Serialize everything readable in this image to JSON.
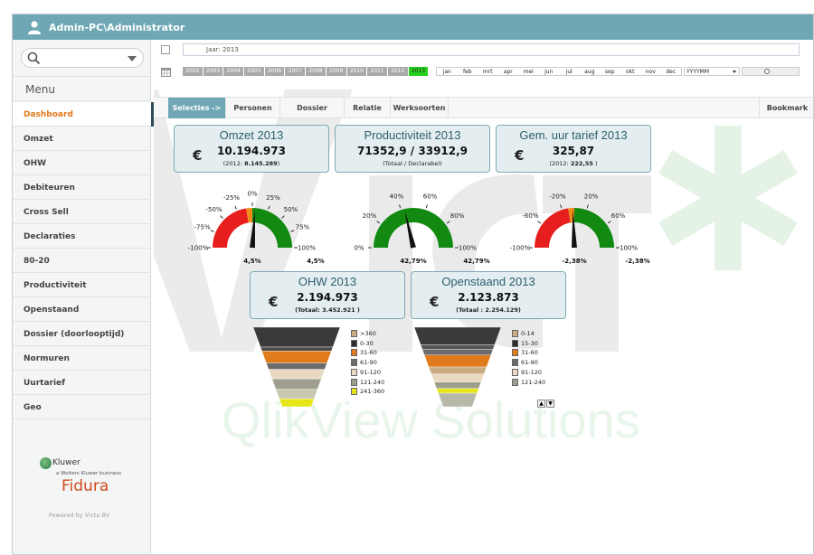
{
  "window": {
    "title": "Admin-PC\\Administrator"
  },
  "sidebar": {
    "menu_title": "Menu",
    "items": [
      {
        "label": "Dashboard",
        "active": true
      },
      {
        "label": "Omzet"
      },
      {
        "label": "OHW"
      },
      {
        "label": "Debiteuren"
      },
      {
        "label": "Cross Sell"
      },
      {
        "label": "Declaraties"
      },
      {
        "label": "80-20"
      },
      {
        "label": "Productiviteit"
      },
      {
        "label": "Openstaand"
      },
      {
        "label": "Dossier (doorlooptijd)"
      },
      {
        "label": "Normuren"
      },
      {
        "label": "Uurtarief"
      },
      {
        "label": "Geo"
      }
    ],
    "logo_kluwer": "Kluwer",
    "logo_kluwer_sub": "a Wolters Kluwer business",
    "logo_fidura": "Fidura",
    "powered_by": "Powered by Victa BV"
  },
  "filters": {
    "jaar_label": "Jaar: 2013",
    "years": [
      "2002",
      "2003",
      "2004",
      "2005",
      "2006",
      "2007",
      "2008",
      "2009",
      "2010",
      "2011",
      "2012",
      "2013"
    ],
    "selected_year": "2013",
    "months": [
      "jan",
      "feb",
      "mrt",
      "apr",
      "mei",
      "jun",
      "jul",
      "aug",
      "sep",
      "okt",
      "nov",
      "dec"
    ],
    "period_select": "YYYYMM"
  },
  "tabs": {
    "items": [
      "Selecties ->",
      "Personen",
      "Dossier",
      "Relatie",
      "Werksoorten"
    ],
    "bookmark": "Bookmark"
  },
  "kpis": {
    "omzet": {
      "title": "Omzet 2013",
      "currency": "€",
      "value": "10.194.973",
      "sub_pre": "(2012: ",
      "sub_val": "8.145.289",
      "sub_post": ")"
    },
    "productiviteit": {
      "title": "Productiviteit 2013",
      "value": "71352,9 / 33912,9",
      "sub": "(Totaal / Declarabel)"
    },
    "uurtarief": {
      "title": "Gem. uur tarief 2013",
      "currency": "€",
      "value": "325,87",
      "sub_pre": "(2012: ",
      "sub_val": "222,55",
      "sub_post": " )"
    },
    "ohw": {
      "title": "OHW 2013",
      "currency": "€",
      "value": "2.194.973",
      "sub": "(Totaal: 3.452.921 )"
    },
    "openstaand": {
      "title": "Openstaand 2013",
      "currency": "€",
      "value": "2.123.873",
      "sub": "(Totaal : 2.254.129)"
    }
  },
  "gauges": {
    "omzet": {
      "min": -100,
      "max": 100,
      "value": 4.5,
      "ticks": [
        "-100%",
        "-75%",
        "-50%",
        "-25%",
        "0%",
        "25%",
        "50%",
        "75%",
        "100%"
      ],
      "label_left": "4,5%",
      "label_right": "4,5%",
      "bands": [
        {
          "from": -100,
          "to": -10,
          "color": "#e61e1e"
        },
        {
          "from": -10,
          "to": 0,
          "color": "#f08a1a"
        },
        {
          "from": 0,
          "to": 100,
          "color": "#128a12"
        }
      ]
    },
    "productiviteit": {
      "min": 0,
      "max": 100,
      "value": 42.79,
      "ticks": [
        "0%",
        "20%",
        "40%",
        "60%",
        "80%",
        "100%"
      ],
      "label_left": "42,79%",
      "label_right": "42,79%",
      "bands": [
        {
          "from": 0,
          "to": 100,
          "color": "#128a12"
        }
      ]
    },
    "uurtarief": {
      "min": -100,
      "max": 100,
      "value": -2.38,
      "ticks": [
        "-100%",
        "-60%",
        "-20%",
        "20%",
        "60%",
        "100%"
      ],
      "label_left": "-2,38%",
      "label_right": "-2,38%",
      "bands": [
        {
          "from": -100,
          "to": -10,
          "color": "#e61e1e"
        },
        {
          "from": -10,
          "to": 0,
          "color": "#f08a1a"
        },
        {
          "from": 0,
          "to": 100,
          "color": "#128a12"
        }
      ]
    }
  },
  "funnels": {
    "ohw": {
      "legend": [
        {
          "label": ">360",
          "color": "#c9ac84"
        },
        {
          "label": "0-30",
          "color": "#2d2d2d"
        },
        {
          "label": "31-60",
          "color": "#e07a1a"
        },
        {
          "label": "61-90",
          "color": "#6b6b6b"
        },
        {
          "label": "91-120",
          "color": "#e8d9c0"
        },
        {
          "label": "121-240",
          "color": "#9e9e8e"
        },
        {
          "label": "241-360",
          "color": "#e6e61a"
        }
      ],
      "shares": [
        0.25,
        0.05,
        0.15,
        0.08,
        0.12,
        0.13,
        0.12,
        0.1
      ]
    },
    "openstaand": {
      "legend": [
        {
          "label": "0-14",
          "color": "#c9ac84"
        },
        {
          "label": "15-30",
          "color": "#2d2d2d"
        },
        {
          "label": "31-60",
          "color": "#e07a1a"
        },
        {
          "label": "61-90",
          "color": "#6b6b6b"
        },
        {
          "label": "91-120",
          "color": "#e8d9c0"
        },
        {
          "label": "121-240",
          "color": "#9e9e8e"
        }
      ],
      "shares": [
        0.22,
        0.06,
        0.07,
        0.15,
        0.09,
        0.1,
        0.08,
        0.06,
        0.17
      ]
    }
  },
  "watermark": {
    "text": "QlikView Solutions",
    "logo_text": "VICTA"
  }
}
